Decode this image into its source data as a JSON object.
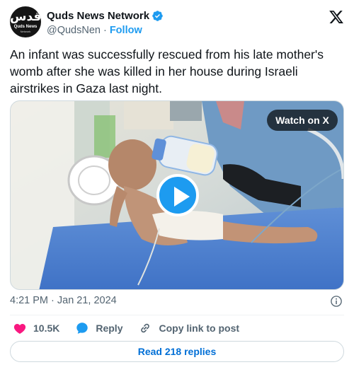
{
  "author": {
    "display_name": "Quds News Network",
    "handle": "@QudsNen",
    "separator": "·",
    "follow_label": "Follow",
    "avatar": {
      "arabic": "قدس",
      "name": "Quds News",
      "sub": "Network"
    }
  },
  "tweet": {
    "text": "An infant was successfully rescued from his late mother's womb after she was killed in her house during Israeli airstrikes in Gaza last night."
  },
  "media": {
    "watch_label": "Watch on X",
    "play_icon": "play-icon"
  },
  "meta": {
    "timestamp": "4:21 PM · Jan 21, 2024"
  },
  "actions": {
    "like_count": "10.5K",
    "reply_label": "Reply",
    "copy_link_label": "Copy link to post"
  },
  "replies": {
    "label": "Read 218 replies"
  },
  "colors": {
    "accent": "#1d9bf0",
    "like": "#f91880",
    "text_secondary": "#536471",
    "link_button": "#006fd6"
  }
}
